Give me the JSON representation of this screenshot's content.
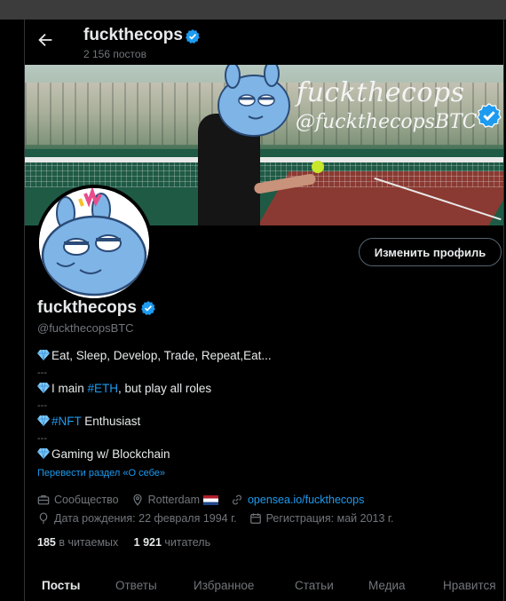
{
  "header": {
    "name": "fuckthecops",
    "posts_count": "2 156 постов"
  },
  "banner": {
    "title": "fuckthecops",
    "handle": "@fuckthecopsBTC"
  },
  "profile": {
    "edit_button": "Изменить профиль",
    "name": "fuckthecops",
    "handle": "@fuckthecopsBTC"
  },
  "bio": {
    "line1": "Eat, Sleep, Develop, Trade, Repeat,Eat...",
    "sep": "---",
    "line2_prefix": "I main ",
    "line2_link": "#ETH",
    "line2_suffix": ", but play all roles",
    "line3_link": "#NFT",
    "line3_suffix": " Enthusiast",
    "line4": "Gaming w/ Blockchain",
    "translate": "Перевести раздел «О себе»"
  },
  "meta": {
    "category": "Сообщество",
    "location": "Rotterdam",
    "website": "opensea.io/fuckthecops",
    "birthday": "Дата рождения: 22 февраля 1994 г.",
    "joined": "Регистрация: май 2013 г."
  },
  "stats": {
    "following_count": "185",
    "following_label": "в читаемых",
    "followers_count": "1 921",
    "followers_label": "читатель"
  },
  "tabs": [
    "Посты",
    "Ответы",
    "Избранное",
    "Статьи",
    "Медиа",
    "Нравится"
  ],
  "colors": {
    "accent": "#1d9bf0",
    "background": "#000000",
    "muted": "#71767b",
    "text": "#e7e9ea"
  }
}
